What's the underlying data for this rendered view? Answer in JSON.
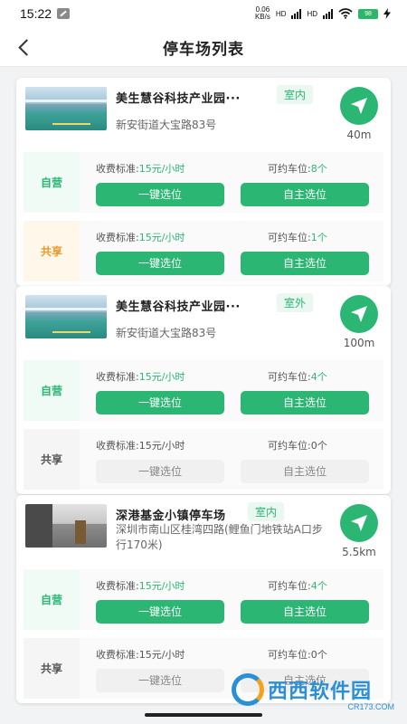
{
  "status_bar": {
    "time": "15:22",
    "net_speed": "0.06",
    "net_unit": "KB/s",
    "hd1": "HD",
    "hd2": "HD",
    "battery": "98"
  },
  "header": {
    "title": "停车场列表"
  },
  "colors": {
    "accent": "#2bb673",
    "share": "#e59a2a"
  },
  "lots": [
    {
      "name": "美生慧谷科技产业园···",
      "tag": "室内",
      "address": "新安街道大宝路83号",
      "distance": "40m",
      "image": "garage-photo",
      "rows": [
        {
          "label": "自营",
          "fee_label": "收费标准:",
          "fee": "15元/小时",
          "avail_label": "可约车位:",
          "avail": "8个",
          "btn_quick": "一键选位",
          "btn_manual": "自主选位",
          "enabled": true
        },
        {
          "label": "共享",
          "fee_label": "收费标准:",
          "fee": "15元/小时",
          "avail_label": "可约车位:",
          "avail": "1个",
          "btn_quick": "一键选位",
          "btn_manual": "自主选位",
          "enabled": true
        }
      ]
    },
    {
      "name": "美生慧谷科技产业园···",
      "tag": "室外",
      "address": "新安街道大宝路83号",
      "distance": "100m",
      "image": "garage-photo",
      "rows": [
        {
          "label": "自营",
          "fee_label": "收费标准:",
          "fee": "15元/小时",
          "avail_label": "可约车位:",
          "avail": "4个",
          "btn_quick": "一键选位",
          "btn_manual": "自主选位",
          "enabled": true
        },
        {
          "label": "共享",
          "fee_label": "收费标准:",
          "fee": "15元/小时",
          "avail_label": "可约车位:",
          "avail": "0个",
          "btn_quick": "一键选位",
          "btn_manual": "自主选位",
          "enabled": false
        }
      ]
    },
    {
      "name": "深港基金小镇停车场",
      "tag": "室内",
      "address": "深圳市南山区桂湾四路(鲤鱼门地铁站A口步行170米)",
      "distance": "5.5km",
      "image": "street-photo",
      "rows": [
        {
          "label": "自营",
          "fee_label": "收费标准:",
          "fee": "15元/小时",
          "avail_label": "可约车位:",
          "avail": "4个",
          "btn_quick": "一键选位",
          "btn_manual": "自主选位",
          "enabled": true
        },
        {
          "label": "共享",
          "fee_label": "收费标准:",
          "fee": "15元/小时",
          "avail_label": "可约车位:",
          "avail": "0个",
          "btn_quick": "一键选位",
          "btn_manual": "自主选位",
          "enabled": false
        }
      ]
    }
  ],
  "watermark": {
    "text": "西西软件园",
    "sub": "CR173.COM"
  }
}
